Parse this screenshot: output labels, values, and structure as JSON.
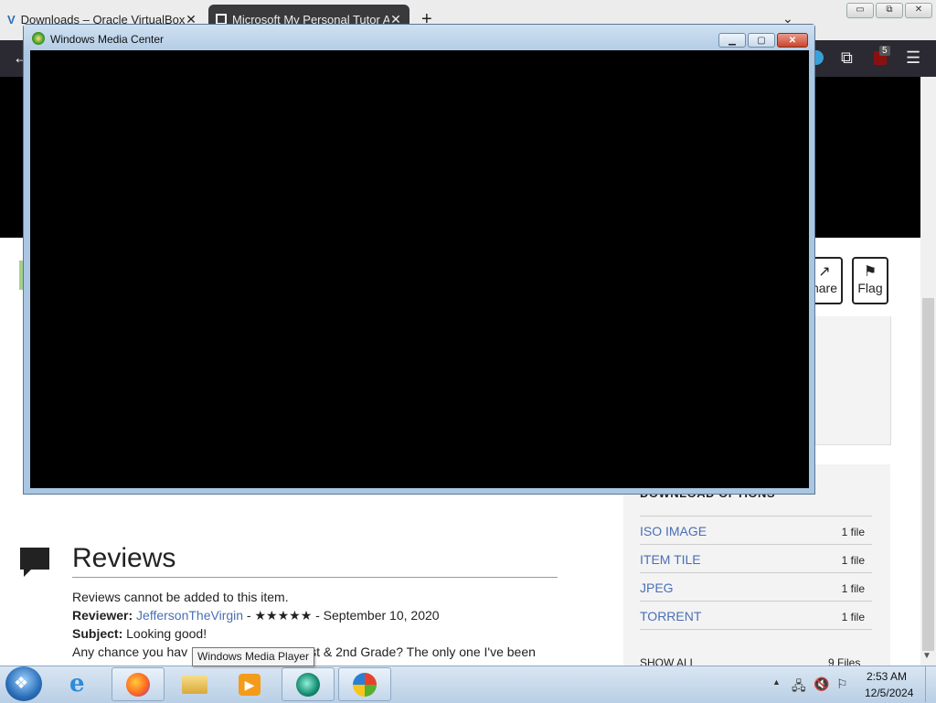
{
  "browser": {
    "tabs": [
      {
        "title": "Downloads – Oracle VirtualBox",
        "close": "✕"
      },
      {
        "title": "Microsoft My Personal Tutor A",
        "close": "✕"
      }
    ],
    "new_tab": "+",
    "tabs_menu": "⌄",
    "window_controls": {
      "minimize": "▭",
      "maximize": "⧉",
      "close": "✕"
    },
    "toolbar": {
      "back": "←",
      "extensions": "⧉",
      "ublock_badge": "5",
      "menu": "☰"
    }
  },
  "page": {
    "actions": [
      {
        "label": "hare",
        "icon": "share-icon"
      },
      {
        "label": "Flag",
        "icon": "flag-icon"
      }
    ],
    "download_options": {
      "heading": "DOWNLOAD OPTIONS",
      "rows": [
        {
          "label": "ISO IMAGE",
          "count": "1 file"
        },
        {
          "label": "ITEM TILE",
          "count": "1 file"
        },
        {
          "label": "JPEG",
          "count": "1 file"
        },
        {
          "label": "TORRENT",
          "count": "1 file"
        }
      ],
      "show_all": "SHOW ALL",
      "show_all_count": "9 Files"
    },
    "reviews": {
      "title": "Reviews",
      "notice": "Reviews cannot be added to this item.",
      "reviewer_label": "Reviewer:",
      "reviewer": "JeffersonTheVirgin",
      "stars": " - ★★★★★ - September 10, 2020",
      "subject_label": "Subject:",
      "subject": " Looking good!",
      "body_start": "Any chance you hav",
      "body_end": "st & 2nd Grade? The only one I've been"
    }
  },
  "wmc_window": {
    "title": "Windows Media Center",
    "min": "▁",
    "max": "▢",
    "close": "✕"
  },
  "tooltip": "Windows Media Player",
  "taskbar": {
    "items": [
      "internet-explorer",
      "firefox",
      "file-explorer",
      "windows-media-player",
      "windows-media-center",
      "windows-logo-app"
    ],
    "clock_time": "2:53 AM",
    "clock_date": "12/5/2024"
  },
  "colors": {
    "link": "#4a6fb5",
    "toolbar": "#2b2a33",
    "wmc_frame": "#a9c6e3"
  }
}
